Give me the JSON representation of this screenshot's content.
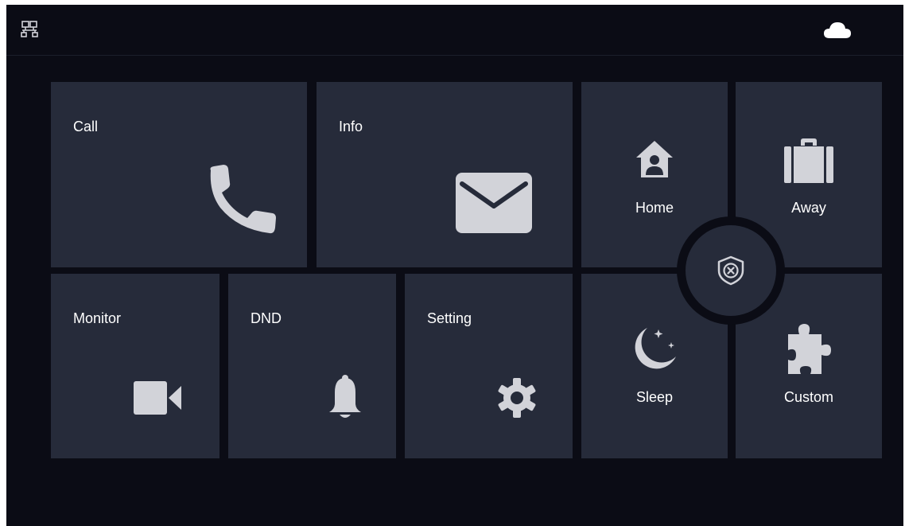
{
  "topbar": {
    "left_icon": "network-status-icon",
    "right_icon": "cloud-icon"
  },
  "tiles": {
    "call": {
      "label": "Call",
      "icon": "phone-icon"
    },
    "info": {
      "label": "Info",
      "icon": "envelope-icon"
    },
    "monitor": {
      "label": "Monitor",
      "icon": "video-camera-icon"
    },
    "dnd": {
      "label": "DND",
      "icon": "bell-icon"
    },
    "setting": {
      "label": "Setting",
      "icon": "gear-icon"
    }
  },
  "arm_modes": {
    "home": {
      "label": "Home",
      "icon": "home-person-icon"
    },
    "away": {
      "label": "Away",
      "icon": "suitcase-icon"
    },
    "sleep": {
      "label": "Sleep",
      "icon": "moon-icon"
    },
    "custom": {
      "label": "Custom",
      "icon": "puzzle-icon"
    },
    "disarm": {
      "icon": "shield-x-icon"
    }
  },
  "colors": {
    "background": "#0b0c15",
    "tile": "#262b3a",
    "icon": "#d2d3d9",
    "text": "#ffffff"
  }
}
